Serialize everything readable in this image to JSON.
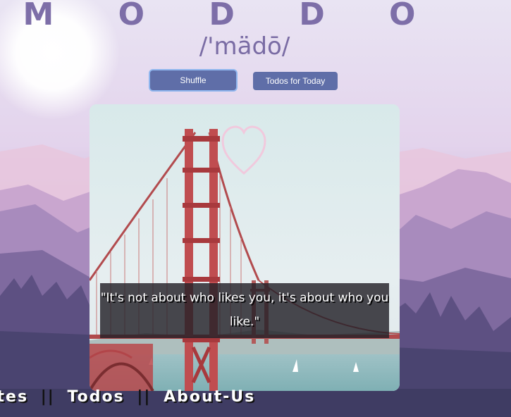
{
  "header": {
    "title": "M O D D O",
    "pronunciation": "/'mädō/"
  },
  "buttons": {
    "shuffle_label": "Shuffle",
    "todos_label": "Todos for Today"
  },
  "card": {
    "quote": "\"It's not about who likes you, it's about who you like.\"",
    "favorite_icon": "heart-outline-icon"
  },
  "bottom_nav": {
    "item1": "ites",
    "item2": "Todos",
    "item3": "About-Us",
    "separator": "||"
  },
  "colors": {
    "accent": "#5f6ea8",
    "title": "#7d6ea8"
  }
}
